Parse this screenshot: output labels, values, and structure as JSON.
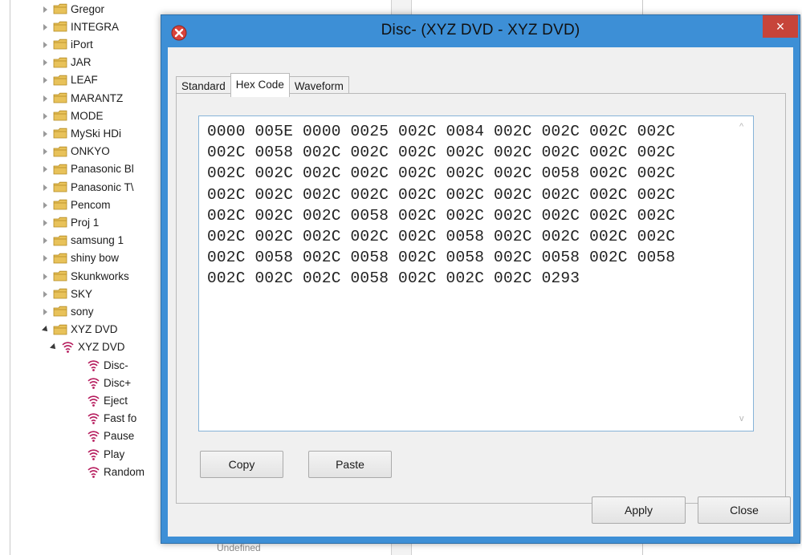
{
  "tree": {
    "items": [
      {
        "label": "Gregor",
        "state": "collapsed",
        "type": "folder"
      },
      {
        "label": "INTEGRA",
        "state": "collapsed",
        "type": "folder"
      },
      {
        "label": "iPort",
        "state": "collapsed",
        "type": "folder"
      },
      {
        "label": "JAR",
        "state": "collapsed",
        "type": "folder"
      },
      {
        "label": "LEAF",
        "state": "collapsed",
        "type": "folder"
      },
      {
        "label": "MARANTZ",
        "state": "collapsed",
        "type": "folder"
      },
      {
        "label": "MODE",
        "state": "collapsed",
        "type": "folder"
      },
      {
        "label": "MySki HDi",
        "state": "collapsed",
        "type": "folder"
      },
      {
        "label": "ONKYO",
        "state": "collapsed",
        "type": "folder"
      },
      {
        "label": "Panasonic Bl",
        "state": "collapsed",
        "type": "folder"
      },
      {
        "label": "Panasonic T\\",
        "state": "collapsed",
        "type": "folder"
      },
      {
        "label": "Pencom",
        "state": "collapsed",
        "type": "folder"
      },
      {
        "label": "Proj 1",
        "state": "collapsed",
        "type": "folder"
      },
      {
        "label": "samsung 1",
        "state": "collapsed",
        "type": "folder"
      },
      {
        "label": "shiny bow",
        "state": "collapsed",
        "type": "folder"
      },
      {
        "label": "Skunkworks",
        "state": "collapsed",
        "type": "folder"
      },
      {
        "label": "SKY",
        "state": "collapsed",
        "type": "folder"
      },
      {
        "label": "sony",
        "state": "collapsed",
        "type": "folder"
      },
      {
        "label": "XYZ DVD",
        "state": "expanded",
        "type": "folder"
      },
      {
        "label": "XYZ DVD",
        "state": "expanded",
        "type": "device"
      },
      {
        "label": "Disc-",
        "state": "leaf",
        "type": "command",
        "selected": true
      },
      {
        "label": "Disc+",
        "state": "leaf",
        "type": "command"
      },
      {
        "label": "Eject",
        "state": "leaf",
        "type": "command"
      },
      {
        "label": "Fast fo",
        "state": "leaf",
        "type": "command"
      },
      {
        "label": "Pause",
        "state": "leaf",
        "type": "command"
      },
      {
        "label": "Play",
        "state": "leaf",
        "type": "command"
      },
      {
        "label": "Random",
        "state": "leaf",
        "type": "command"
      }
    ],
    "undefined_text": "Undefined"
  },
  "dialog": {
    "title": "Disc- (XYZ DVD - XYZ DVD)",
    "close_glyph": "×",
    "tabs": [
      {
        "label": "Standard",
        "active": false
      },
      {
        "label": "Hex Code",
        "active": true
      },
      {
        "label": "Waveform",
        "active": false
      }
    ],
    "hex_code": "0000 005E 0000 0025 002C 0084 002C 002C 002C 002C 002C 0058 002C 002C 002C 002C 002C 002C 002C 002C 002C 002C 002C 002C 002C 002C 002C 0058 002C 002C 002C 002C 002C 002C 002C 002C 002C 002C 002C 002C 002C 002C 002C 0058 002C 002C 002C 002C 002C 002C 002C 002C 002C 002C 002C 0058 002C 002C 002C 002C 002C 0058 002C 0058 002C 0058 002C 0058 002C 0058 002C 002C 002C 0058 002C 002C 002C 0293",
    "copy_label": "Copy",
    "paste_label": "Paste",
    "apply_label": "Apply",
    "close_label": "Close"
  },
  "colors": {
    "dialog_frame": "#3d8fd6",
    "close_button": "#c7443a",
    "folder": "#e8c25a",
    "signal_icon": "#b5195b"
  }
}
